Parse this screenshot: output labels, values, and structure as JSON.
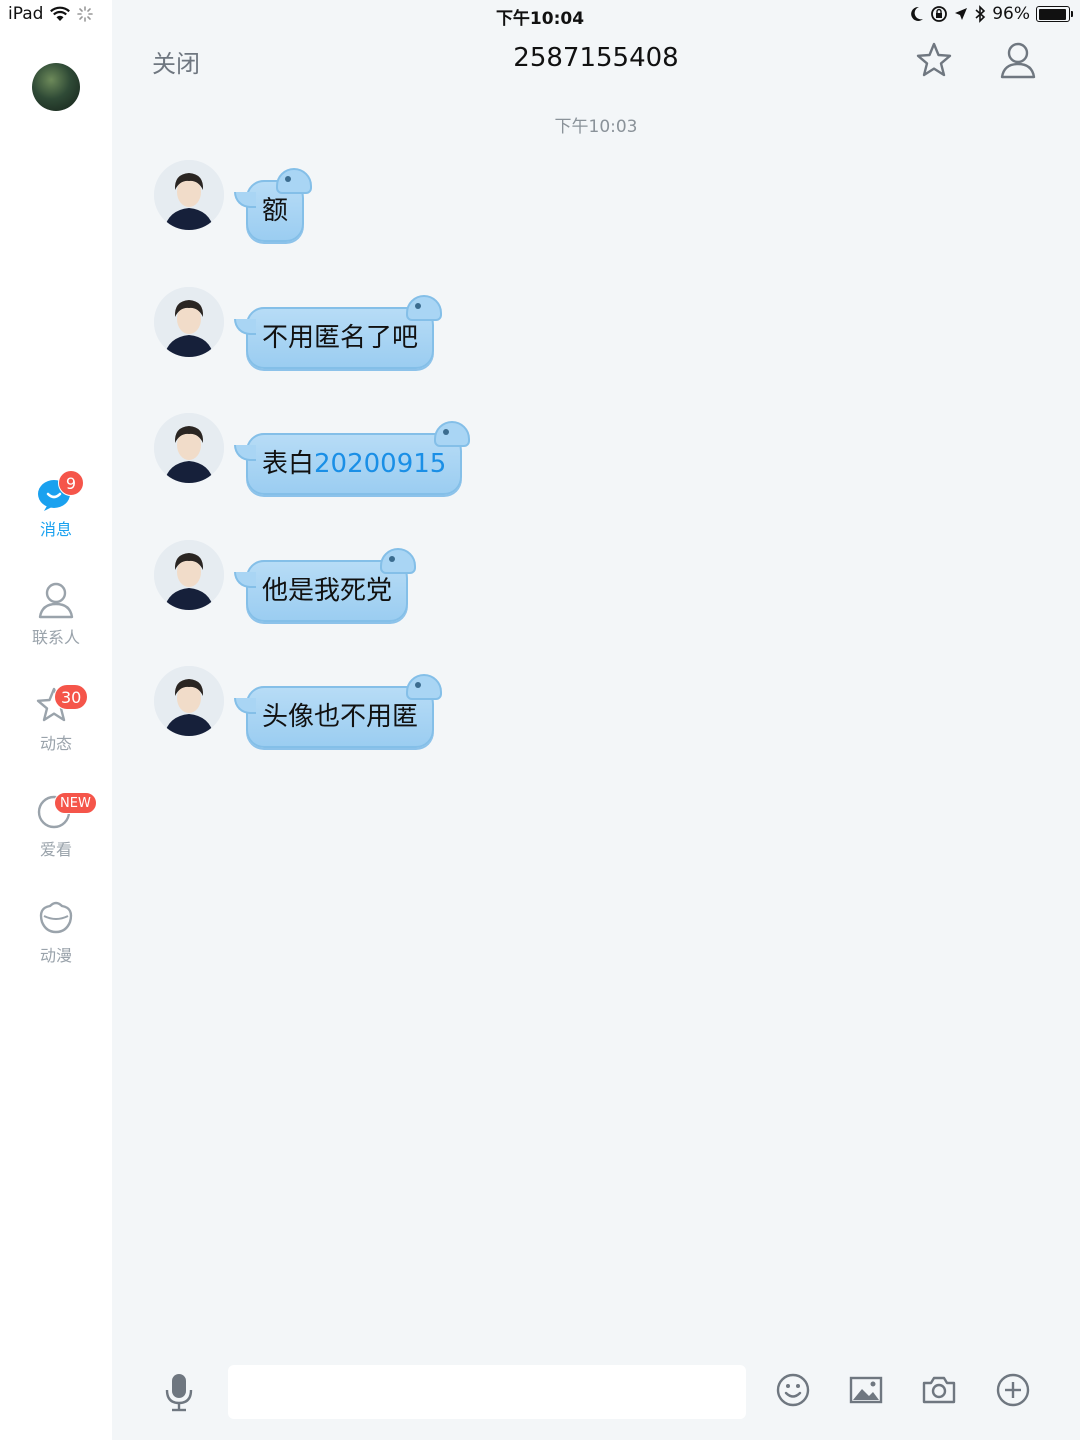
{
  "status_bar": {
    "device": "iPad",
    "time": "下午10:04",
    "battery": "96%",
    "battery_level": 0.96
  },
  "sidebar": {
    "items": [
      {
        "label": "消息",
        "badge": "9",
        "icon": "message-bubble-icon",
        "active": true
      },
      {
        "label": "联系人",
        "badge": "",
        "icon": "contact-person-icon",
        "active": false
      },
      {
        "label": "动态",
        "badge": "30",
        "icon": "star-icon",
        "active": false
      },
      {
        "label": "爱看",
        "badge": "NEW",
        "icon": "watch-circle-icon",
        "active": false
      },
      {
        "label": "动漫",
        "badge": "",
        "icon": "anime-head-icon",
        "active": false
      }
    ]
  },
  "header": {
    "close_label": "关闭",
    "title": "2587155408"
  },
  "chat": {
    "timestamp": "下午10:03",
    "messages": [
      {
        "text": "额",
        "link": ""
      },
      {
        "text": "不用匿名了吧",
        "link": ""
      },
      {
        "text": "表白",
        "link": "20200915"
      },
      {
        "text": "他是我死党",
        "link": ""
      },
      {
        "text": "头像也不用匿",
        "link": ""
      }
    ]
  },
  "input": {
    "placeholder": ""
  },
  "colors": {
    "accent": "#1aa1ef",
    "badge": "#f5554a",
    "bubble": "#a9d5f4",
    "background": "#f3f6f8"
  }
}
